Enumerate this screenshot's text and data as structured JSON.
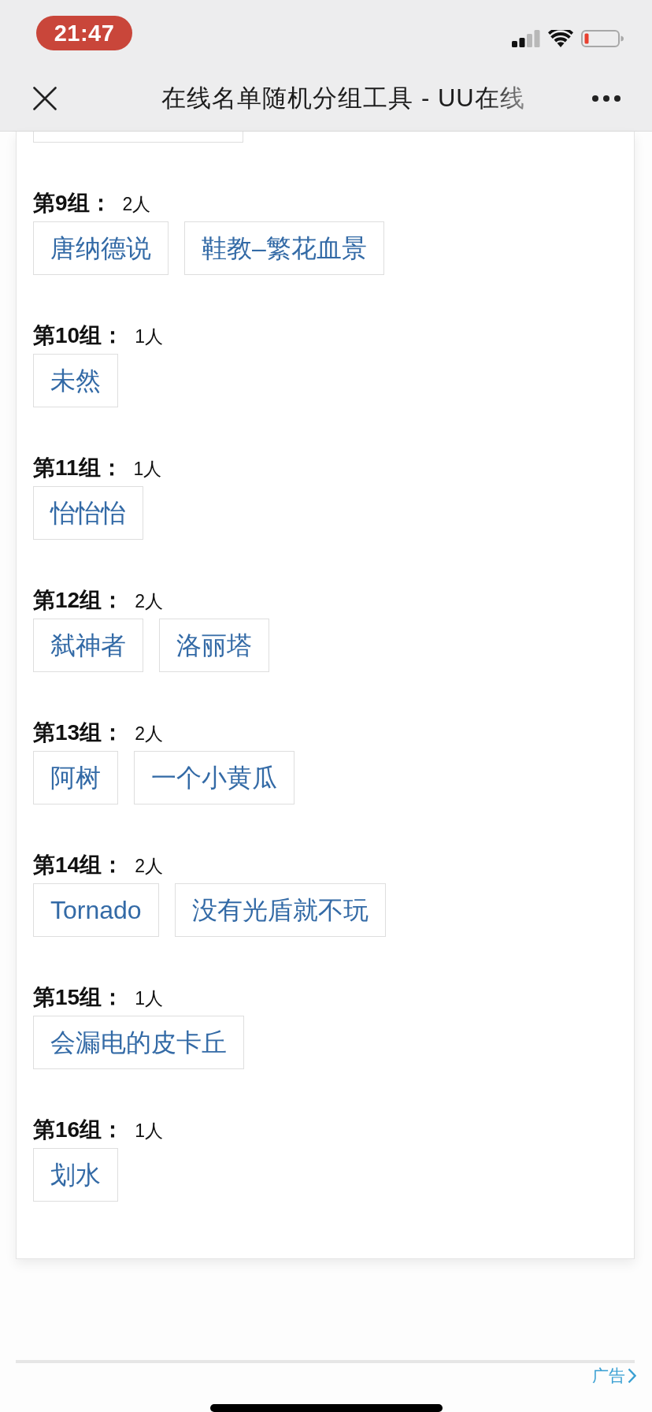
{
  "status_bar": {
    "time": "21:47"
  },
  "nav_bar": {
    "title": "在线名单随机分组工具 - UU在线"
  },
  "top_fragment": {
    "kind": "tag"
  },
  "groups": [
    {
      "label": "第9组：",
      "count": "2人",
      "members": [
        "唐纳德说",
        "鞋教–繁花血景"
      ]
    },
    {
      "label": "第10组：",
      "count": "1人",
      "members": [
        "未然"
      ]
    },
    {
      "label": "第11组：",
      "count": "1人",
      "members": [
        "怡怡怡"
      ]
    },
    {
      "label": "第12组：",
      "count": "2人",
      "members": [
        "弑神者",
        "洛丽塔"
      ]
    },
    {
      "label": "第13组：",
      "count": "2人",
      "members": [
        "阿树",
        "一个小黄瓜"
      ]
    },
    {
      "label": "第14组：",
      "count": "2人",
      "members": [
        "Tornado",
        "没有光盾就不玩"
      ]
    },
    {
      "label": "第15组：",
      "count": "1人",
      "members": [
        "会漏电的皮卡丘"
      ]
    },
    {
      "label": "第16组：",
      "count": "1人",
      "members": [
        "划水"
      ]
    }
  ],
  "ad": {
    "label": "广告"
  }
}
